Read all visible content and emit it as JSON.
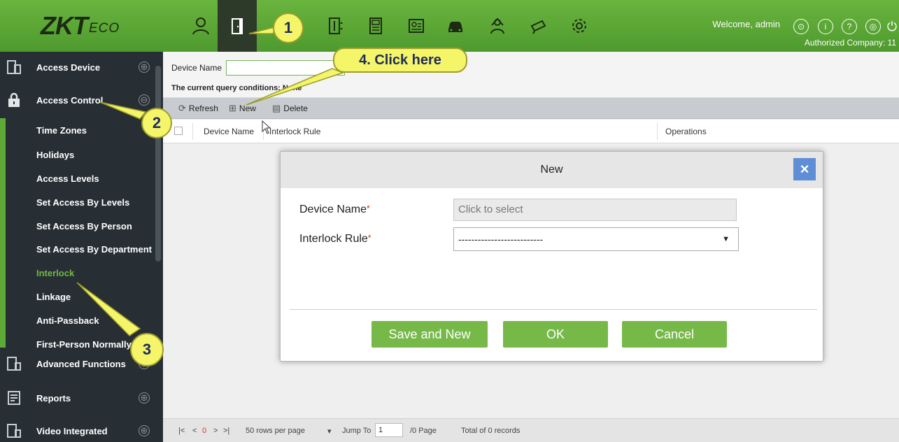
{
  "header": {
    "logo_main": "ZKT",
    "logo_sub": "ECO",
    "welcome": "Welcome, admin",
    "authorized": "Authorized Company: 11",
    "modules": [
      "personnel-icon",
      "access-door-icon",
      "elevator-icon",
      "attendance-icon",
      "visitor-icon",
      "parking-icon",
      "patrol-icon",
      "camera-icon",
      "settings-icon"
    ],
    "right_icons": [
      "user-circle-icon",
      "info-icon",
      "help-icon",
      "account-icon",
      "power-icon"
    ],
    "colors": {
      "topbar": "#5aa63a",
      "active_module": "#2e3a29"
    }
  },
  "sidebar": {
    "sections": [
      {
        "label": "Access Device",
        "toggle": "⊕"
      },
      {
        "label": "Access Control",
        "toggle": "⊖"
      },
      {
        "label": "Advanced Functions",
        "toggle": "⊕"
      },
      {
        "label": "Reports",
        "toggle": "⊕"
      },
      {
        "label": "Video Integrated",
        "toggle": "⊕"
      }
    ],
    "items": [
      {
        "label": "Time Zones"
      },
      {
        "label": "Holidays"
      },
      {
        "label": "Access Levels"
      },
      {
        "label": "Set Access By Levels"
      },
      {
        "label": "Set Access By Person"
      },
      {
        "label": "Set Access By Department"
      },
      {
        "label": "Interlock",
        "active": true
      },
      {
        "label": "Linkage"
      },
      {
        "label": "Anti-Passback"
      },
      {
        "label": "First-Person Normally Open"
      }
    ],
    "colors": {
      "bg": "#272f34",
      "active_text": "#71b944"
    }
  },
  "filter": {
    "device_name_label": "Device Name",
    "query_condition": "The current query conditions: None"
  },
  "toolbar": {
    "refresh": "Refresh",
    "new": "New",
    "delete": "Delete"
  },
  "table": {
    "columns": [
      "Device Name",
      "Interlock Rule",
      "Operations"
    ],
    "rows": []
  },
  "pager": {
    "first": "|<",
    "prev": "<",
    "current": "0",
    "next": ">",
    "last": ">|",
    "rows_per_page": "50 rows per page",
    "jump_to": "Jump To",
    "jump_value": "1",
    "page_total": "/0 Page",
    "total_records": "Total of 0 records"
  },
  "dialog": {
    "title": "New",
    "close": "×",
    "device_name_label": "Device Name",
    "device_name_placeholder": "Click to select",
    "interlock_rule_label": "Interlock Rule",
    "interlock_rule_value": "--------------------------",
    "required_mark": "*",
    "buttons": {
      "save_and_new": "Save and New",
      "ok": "OK",
      "cancel": "Cancel"
    },
    "colors": {
      "button": "#76b948",
      "close": "#5f8ed6"
    }
  },
  "callouts": {
    "c1": "1",
    "c2": "2",
    "c3": "3",
    "c4": "4. Click here"
  }
}
